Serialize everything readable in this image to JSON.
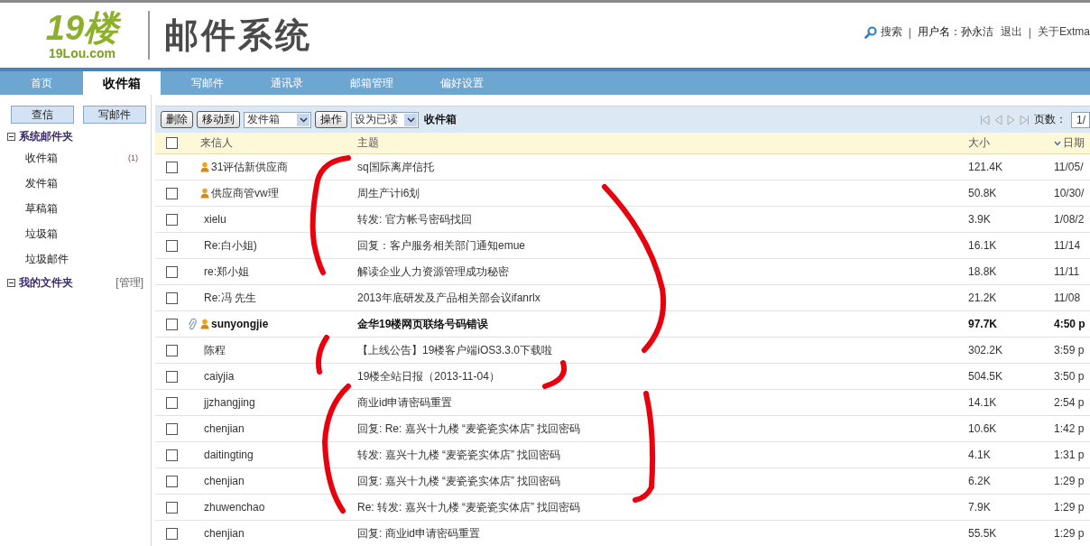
{
  "header": {
    "logo_main": "19楼",
    "logo_sub": "19Lou.com",
    "title": "邮件系统",
    "links": [
      {
        "kind": "search",
        "text": "搜索"
      },
      {
        "kind": "sep",
        "text": "|"
      },
      {
        "kind": "user",
        "text": "用户名：孙永洁"
      },
      {
        "kind": "link",
        "text": "退出"
      },
      {
        "kind": "sep",
        "text": "|"
      },
      {
        "kind": "link",
        "text": "关于Extma"
      }
    ]
  },
  "nav": [
    {
      "label": "首页",
      "selected": false
    },
    {
      "label": "收件箱",
      "selected": true
    },
    {
      "label": "写邮件",
      "selected": false
    },
    {
      "label": "通讯录",
      "selected": false
    },
    {
      "label": "邮箱管理",
      "selected": false
    },
    {
      "label": "偏好设置",
      "selected": false
    }
  ],
  "sidebar": {
    "buttons": [
      "查信",
      "写邮件"
    ],
    "groups": [
      {
        "name": "系统邮件夹",
        "expanded": true,
        "children": [
          {
            "name": "收件箱",
            "count": "(1)"
          },
          {
            "name": "发件箱"
          },
          {
            "name": "草稿箱"
          },
          {
            "name": "垃圾箱"
          },
          {
            "name": "垃圾邮件"
          }
        ]
      },
      {
        "name": "我的文件夹",
        "expanded": true,
        "action": "[管理]"
      }
    ]
  },
  "toolbar": {
    "delete": "删除",
    "move": "移动到",
    "move_target": "发件箱",
    "operate": "操作",
    "mark_as": "设为已读",
    "folder": "收件箱",
    "page_label": "页数：",
    "page_value": "1/"
  },
  "table": {
    "select_all_checked": false,
    "columns": [
      {
        "label": "来信人",
        "sorted": false
      },
      {
        "label": "主题",
        "sorted": false
      },
      {
        "label": "大小",
        "sorted": false
      },
      {
        "label": "日期",
        "sorted": true
      }
    ],
    "rows": [
      {
        "checked": false,
        "unread": false,
        "attachment": false,
        "contact": true,
        "sender": "31评估新供应商",
        "subject": "sq国际离岸信托",
        "size": "121.4K",
        "date": "11/05/"
      },
      {
        "checked": false,
        "unread": false,
        "attachment": false,
        "contact": true,
        "sender": "供应商管vw理",
        "subject": "周生产计i6划",
        "size": "50.8K",
        "date": "10/30/"
      },
      {
        "checked": false,
        "unread": false,
        "attachment": false,
        "contact": false,
        "sender": "xielu",
        "subject": "转发: 官方帐号密码找回",
        "size": "3.9K",
        "date": "1/08/2"
      },
      {
        "checked": false,
        "unread": false,
        "attachment": false,
        "contact": false,
        "sender": "Re:白小姐)",
        "subject": "回复：客户服务相关部门通知emue",
        "size": "16.1K",
        "date": "11/14"
      },
      {
        "checked": false,
        "unread": false,
        "attachment": false,
        "contact": false,
        "sender": "re:郑小姐",
        "subject": "解读企业人力资源管理成功秘密",
        "size": "18.8K",
        "date": "11/11"
      },
      {
        "checked": false,
        "unread": false,
        "attachment": false,
        "contact": false,
        "sender": "Re:冯 先生",
        "subject": "2013年底研发及产品相关部会议ifanrlx",
        "size": "21.2K",
        "date": "11/08"
      },
      {
        "checked": false,
        "unread": true,
        "attachment": true,
        "contact": true,
        "sender": "sunyongjie",
        "subject": "金华19楼网页联络号码错误",
        "size": "97.7K",
        "date": "4:50 p"
      },
      {
        "checked": false,
        "unread": false,
        "attachment": false,
        "contact": false,
        "sender": "陈程",
        "subject": "【上线公告】19楼客户端iOS3.3.0下载啦",
        "size": "302.2K",
        "date": "3:59 p"
      },
      {
        "checked": false,
        "unread": false,
        "attachment": false,
        "contact": false,
        "sender": "caiyjia",
        "subject": "19楼全站日报（2013-11-04）",
        "size": "504.5K",
        "date": "3:50 p"
      },
      {
        "checked": false,
        "unread": false,
        "attachment": false,
        "contact": false,
        "sender": "jjzhangjing",
        "subject": "商业id申请密码重置",
        "size": "14.1K",
        "date": "2:54 p"
      },
      {
        "checked": false,
        "unread": false,
        "attachment": false,
        "contact": false,
        "sender": "chenjian",
        "subject": "回复: Re: 嘉兴十九楼 “麦瓷瓷实体店” 找回密码",
        "size": "10.6K",
        "date": "1:42 p"
      },
      {
        "checked": false,
        "unread": false,
        "attachment": false,
        "contact": false,
        "sender": "daitingting",
        "subject": "转发: 嘉兴十九楼 “麦瓷瓷实体店” 找回密码",
        "size": "4.1K",
        "date": "1:31 p"
      },
      {
        "checked": false,
        "unread": false,
        "attachment": false,
        "contact": false,
        "sender": "chenjian",
        "subject": "回复: 嘉兴十九楼 “麦瓷瓷实体店” 找回密码",
        "size": "6.2K",
        "date": "1:29 p"
      },
      {
        "checked": false,
        "unread": false,
        "attachment": false,
        "contact": false,
        "sender": "zhuwenchao",
        "subject": "Re: 转发: 嘉兴十九楼 “麦瓷瓷实体店” 找回密码",
        "size": "7.9K",
        "date": "1:29 p"
      },
      {
        "checked": false,
        "unread": false,
        "attachment": false,
        "contact": false,
        "sender": "chenjian",
        "subject": "回复:  商业id申请密码重置",
        "size": "55.5K",
        "date": "1:29 p"
      }
    ]
  }
}
